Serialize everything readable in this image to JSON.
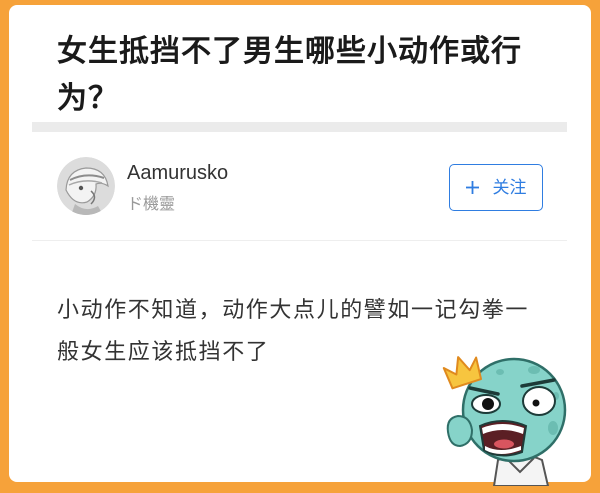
{
  "question": {
    "title": "女生抵挡不了男生哪些小动作或行为？"
  },
  "author": {
    "name": "Aamurusko",
    "subtitle": "ド機靈",
    "avatar_icon": "avatar-image"
  },
  "follow_button": {
    "label": "关注",
    "icon": "plus-icon"
  },
  "answer": {
    "text": "小动作不知道，动作大点儿的譬如一记勾拳一般女生应该抵挡不了"
  },
  "decorations": {
    "sticker_icon": "angry-cartoon-sticker-icon",
    "crown_icon": "crown-icon"
  },
  "colors": {
    "frame": "#f6a23a",
    "title_text": "#1a1a1a",
    "body_text": "#333333",
    "muted_text": "#999999",
    "accent_blue": "#2f7de1",
    "separator": "#ebebeb",
    "mascot_skin": "#86d3c9",
    "crown": "#f7c53f"
  }
}
